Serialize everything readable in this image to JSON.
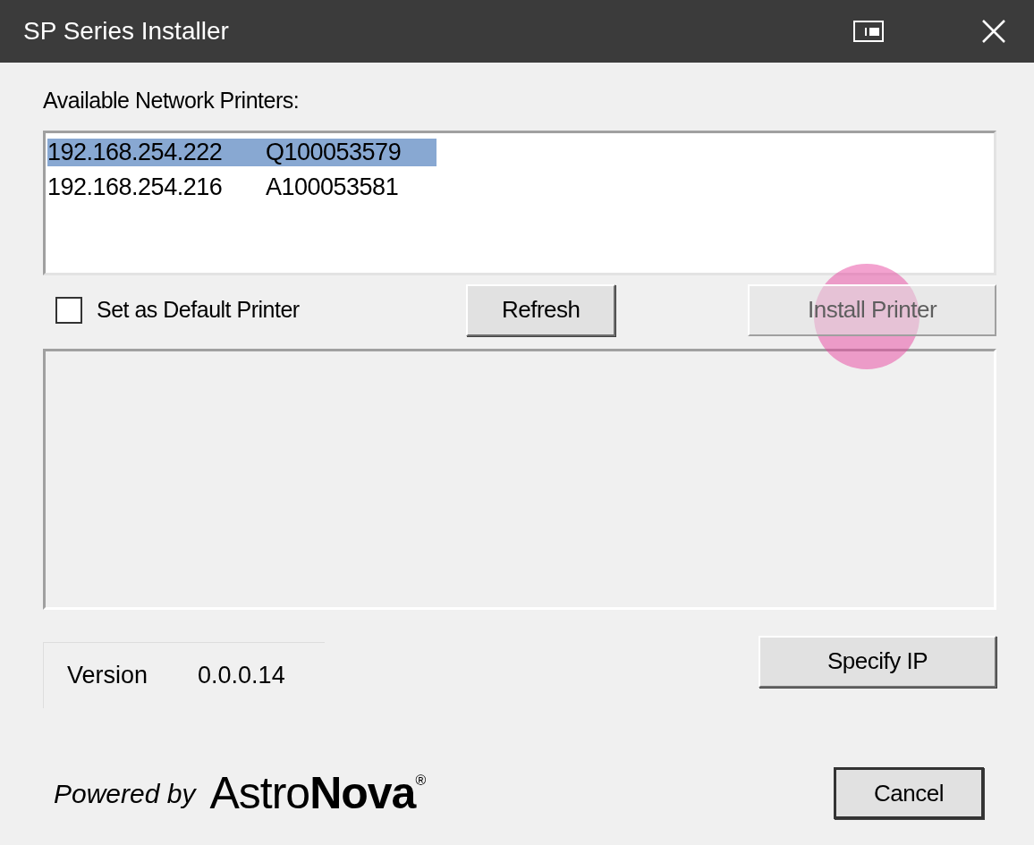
{
  "window": {
    "title": "SP Series Installer"
  },
  "printers_label": "Available Network Printers:",
  "printers": [
    {
      "ip": "192.168.254.222",
      "serial": "Q100053579",
      "selected": true
    },
    {
      "ip": "192.168.254.216",
      "serial": "A100053581",
      "selected": false
    }
  ],
  "default_printer": {
    "label": "Set as Default Printer",
    "checked": false
  },
  "buttons": {
    "refresh": {
      "label": "Refresh",
      "disabled": false
    },
    "install": {
      "label": "Install Printer",
      "disabled": true,
      "highlighted": true
    },
    "specify_ip": {
      "label": "Specify IP",
      "disabled": false
    },
    "cancel": {
      "label": "Cancel",
      "disabled": false
    }
  },
  "version": {
    "label": "Version",
    "value": "0.0.0.14"
  },
  "branding": {
    "prefix": "Powered by",
    "logo": "Astro**Nova**$^{®}$"
  }
}
